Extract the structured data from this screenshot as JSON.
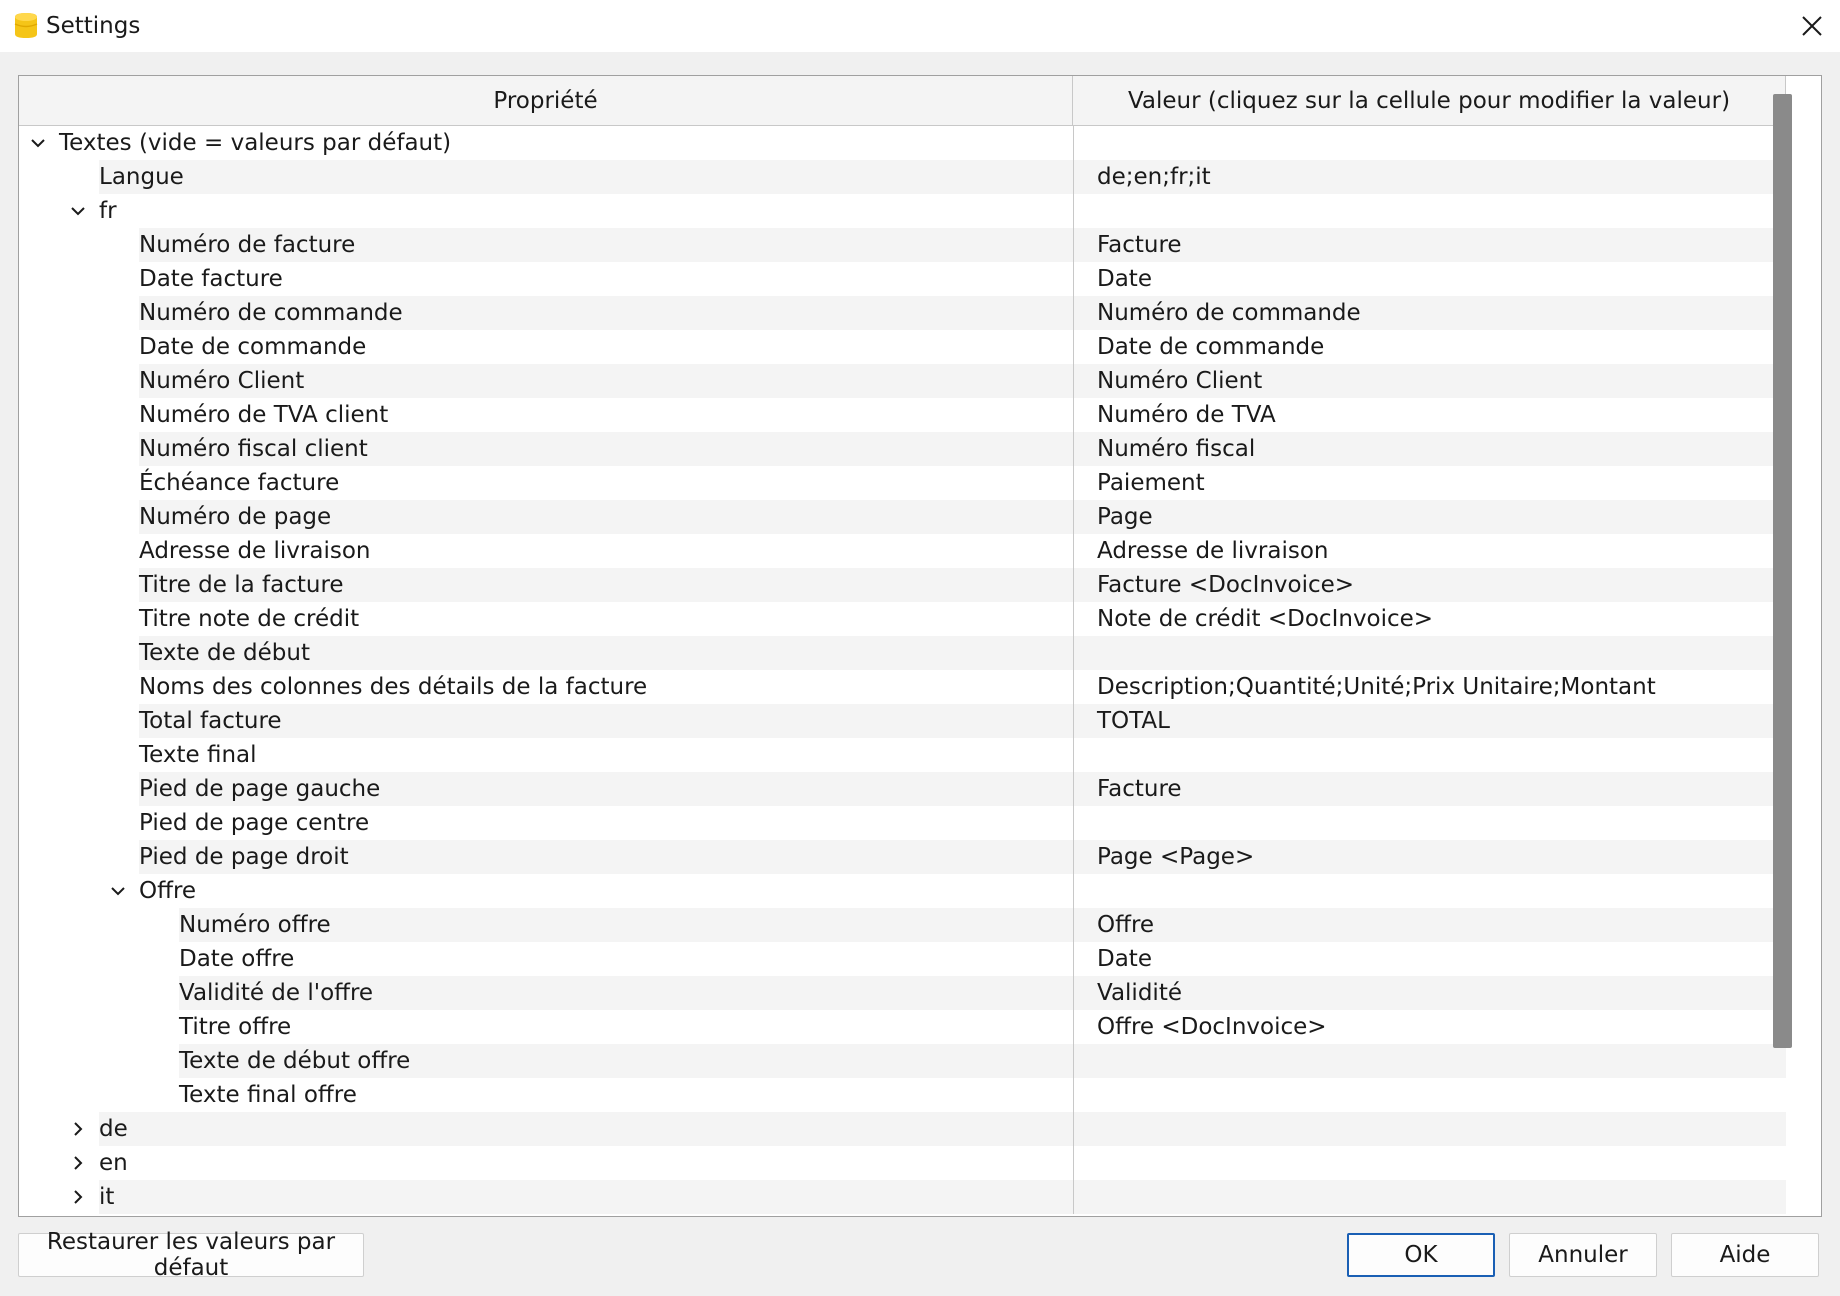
{
  "window": {
    "title": "Settings",
    "close_label": "×"
  },
  "grid": {
    "headers": {
      "property": "Propriété",
      "value": "Valeur (cliquez sur la cellule pour modifier la valeur)"
    },
    "rows": [
      {
        "label": "Textes (vide = valeurs par défaut)",
        "value": "",
        "level": 0,
        "expander": "expanded",
        "name": "group-textes"
      },
      {
        "label": "Langue",
        "value": "de;en;fr;it",
        "level": 1,
        "expander": "none",
        "name": "langue"
      },
      {
        "label": "fr",
        "value": "",
        "level": 1,
        "expander": "expanded",
        "name": "group-fr"
      },
      {
        "label": "Numéro de facture",
        "value": "Facture",
        "level": 2,
        "expander": "none",
        "name": "numero-de-facture"
      },
      {
        "label": "Date facture",
        "value": "Date",
        "level": 2,
        "expander": "none",
        "name": "date-facture"
      },
      {
        "label": "Numéro de commande",
        "value": "Numéro de commande",
        "level": 2,
        "expander": "none",
        "name": "numero-de-commande"
      },
      {
        "label": "Date de commande",
        "value": "Date de commande",
        "level": 2,
        "expander": "none",
        "name": "date-de-commande"
      },
      {
        "label": "Numéro Client",
        "value": "Numéro Client",
        "level": 2,
        "expander": "none",
        "name": "numero-client"
      },
      {
        "label": "Numéro de TVA client",
        "value": "Numéro de TVA",
        "level": 2,
        "expander": "none",
        "name": "numero-tva-client"
      },
      {
        "label": "Numéro fiscal client",
        "value": "Numéro fiscal",
        "level": 2,
        "expander": "none",
        "name": "numero-fiscal-client"
      },
      {
        "label": "Échéance facture",
        "value": "Paiement",
        "level": 2,
        "expander": "none",
        "name": "echeance-facture"
      },
      {
        "label": "Numéro de page",
        "value": "Page",
        "level": 2,
        "expander": "none",
        "name": "numero-de-page"
      },
      {
        "label": "Adresse de livraison",
        "value": "Adresse de livraison",
        "level": 2,
        "expander": "none",
        "name": "adresse-de-livraison"
      },
      {
        "label": "Titre de la facture",
        "value": "Facture <DocInvoice>",
        "level": 2,
        "expander": "none",
        "name": "titre-de-la-facture"
      },
      {
        "label": "Titre note de crédit",
        "value": "Note de crédit <DocInvoice>",
        "level": 2,
        "expander": "none",
        "name": "titre-note-de-credit"
      },
      {
        "label": "Texte de début",
        "value": "",
        "level": 2,
        "expander": "none",
        "name": "texte-de-debut"
      },
      {
        "label": "Noms des colonnes des détails de la facture",
        "value": "Description;Quantité;Unité;Prix Unitaire;Montant",
        "level": 2,
        "expander": "none",
        "name": "noms-des-colonnes"
      },
      {
        "label": "Total facture",
        "value": "TOTAL",
        "level": 2,
        "expander": "none",
        "name": "total-facture"
      },
      {
        "label": "Texte final",
        "value": "",
        "level": 2,
        "expander": "none",
        "name": "texte-final"
      },
      {
        "label": "Pied de page gauche",
        "value": "Facture",
        "level": 2,
        "expander": "none",
        "name": "pied-de-page-gauche"
      },
      {
        "label": "Pied de page centre",
        "value": "",
        "level": 2,
        "expander": "none",
        "name": "pied-de-page-centre"
      },
      {
        "label": "Pied de page droit",
        "value": "Page <Page>",
        "level": 2,
        "expander": "none",
        "name": "pied-de-page-droit"
      },
      {
        "label": "Offre",
        "value": "",
        "level": 2,
        "expander": "expanded",
        "name": "group-offre"
      },
      {
        "label": "Numéro offre",
        "value": "Offre",
        "level": 3,
        "expander": "none",
        "name": "numero-offre"
      },
      {
        "label": "Date offre",
        "value": "Date",
        "level": 3,
        "expander": "none",
        "name": "date-offre"
      },
      {
        "label": "Validité de l'offre",
        "value": "Validité",
        "level": 3,
        "expander": "none",
        "name": "validite-offre"
      },
      {
        "label": "Titre offre",
        "value": "Offre <DocInvoice>",
        "level": 3,
        "expander": "none",
        "name": "titre-offre"
      },
      {
        "label": "Texte de début offre",
        "value": "",
        "level": 3,
        "expander": "none",
        "name": "texte-de-debut-offre"
      },
      {
        "label": "Texte final offre",
        "value": "",
        "level": 3,
        "expander": "none",
        "name": "texte-final-offre"
      },
      {
        "label": "de",
        "value": "",
        "level": 1,
        "expander": "collapsed",
        "name": "group-de"
      },
      {
        "label": "en",
        "value": "",
        "level": 1,
        "expander": "collapsed",
        "name": "group-en"
      },
      {
        "label": "it",
        "value": "",
        "level": 1,
        "expander": "collapsed",
        "name": "group-it"
      }
    ]
  },
  "buttons": {
    "restore": "Restaurer les valeurs par défaut",
    "ok": "OK",
    "cancel": "Annuler",
    "help": "Aide"
  },
  "icons": {
    "app": "app-logo-icon",
    "close": "close-icon",
    "expanded": "chevron-down-icon",
    "collapsed": "chevron-right-icon"
  },
  "colors": {
    "app_icon": "#f5c518",
    "ok_border": "#1a5fb4",
    "scroll_thumb": "#8a8a8a",
    "row_shade": "#f4f4f4"
  }
}
